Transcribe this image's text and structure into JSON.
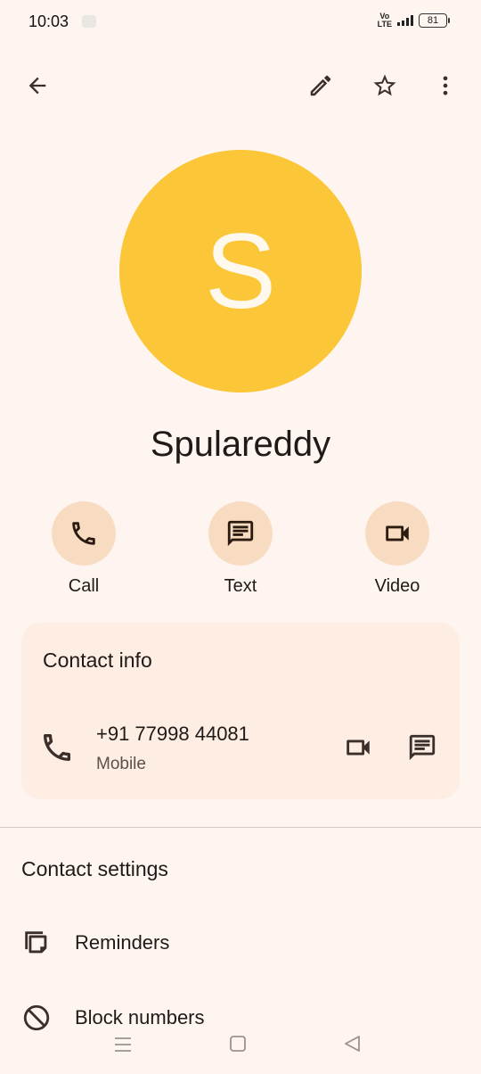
{
  "status_bar": {
    "time": "10:03",
    "network": "Vo LTE",
    "battery": "81"
  },
  "toolbar": {
    "back": "arrow-left-icon",
    "edit": "pencil-icon",
    "favorite": "star-outline-icon",
    "more": "more-vert-icon"
  },
  "contact": {
    "initial": "S",
    "name": "Spulareddy",
    "avatar_color": "#fbc638"
  },
  "actions": [
    {
      "label": "Call",
      "icon": "phone-icon"
    },
    {
      "label": "Text",
      "icon": "message-icon"
    },
    {
      "label": "Video",
      "icon": "videocam-icon"
    }
  ],
  "contact_info": {
    "title": "Contact info",
    "phone": {
      "number": "+91 77998 44081",
      "type": "Mobile"
    }
  },
  "contact_settings": {
    "title": "Contact settings",
    "items": [
      {
        "label": "Reminders",
        "icon": "reminders-icon"
      },
      {
        "label": "Block numbers",
        "icon": "block-icon"
      }
    ]
  },
  "nav": {
    "recents": "menu-icon",
    "home": "square-icon",
    "back": "triangle-back-icon"
  }
}
